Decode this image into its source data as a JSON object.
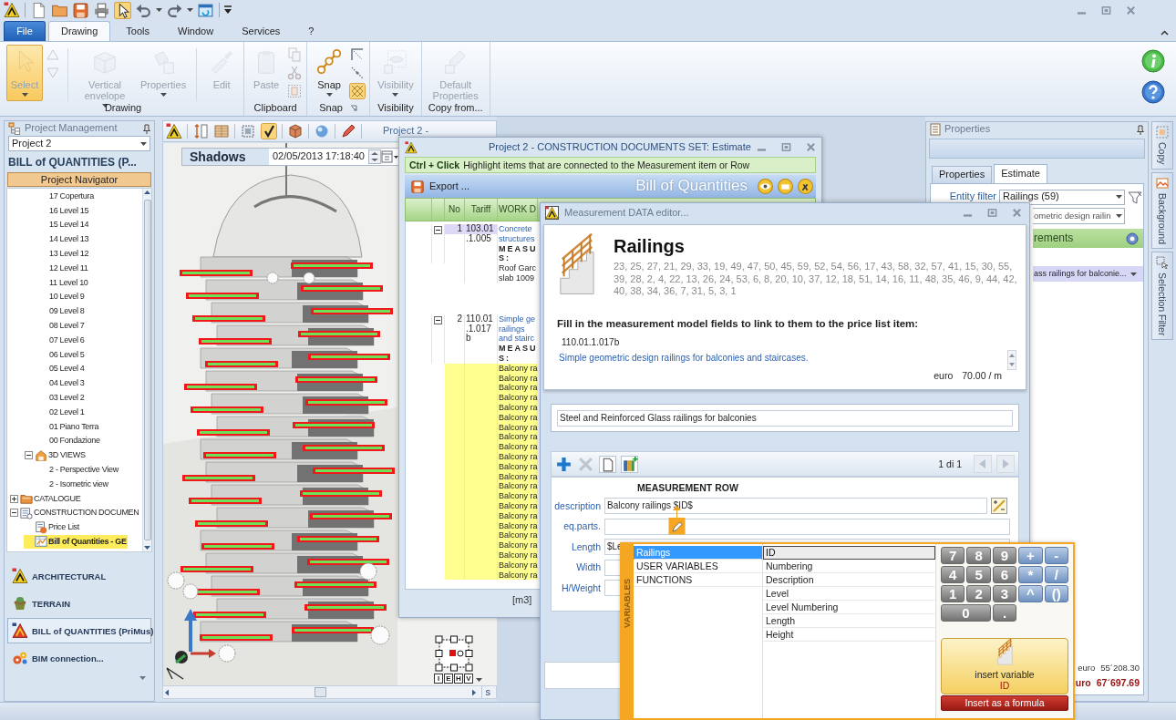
{
  "quick_access": [
    {
      "pressed": false
    },
    {
      "pressed": false
    },
    {
      "pressed": false
    },
    {
      "pressed": false
    },
    {
      "pressed": true
    },
    {
      "pressed": false,
      "dropdown": true
    },
    {
      "pressed": false,
      "dropdown": true
    },
    {
      "pressed": false
    }
  ],
  "ribbon": {
    "tabs": [
      {
        "label": "File",
        "kind": "application",
        "selected": false
      },
      {
        "label": "Drawing",
        "kind": "tab",
        "selected": true
      },
      {
        "label": "Tools",
        "kind": "tab",
        "selected": false
      },
      {
        "label": "Window",
        "kind": "tab",
        "selected": false
      },
      {
        "label": "Services",
        "kind": "tab",
        "selected": false
      },
      {
        "label": "?",
        "kind": "tab",
        "selected": false
      }
    ],
    "groups": [
      {
        "label": "Drawing",
        "buttons": [
          {
            "kind": "large",
            "label": "Select",
            "disabled": true,
            "pressed": true,
            "dropdown": true
          },
          {
            "kind": "small_stack",
            "items": [
              {
                "disabled": true,
                "pressed": false
              },
              {
                "disabled": true,
                "pressed": false
              }
            ]
          },
          {
            "kind": "separator"
          },
          {
            "kind": "large",
            "label": "Vertical envelope",
            "disabled": true,
            "pressed": false,
            "dropdown": true
          },
          {
            "kind": "large",
            "label": "Properties",
            "disabled": true,
            "pressed": false,
            "dropdown": true
          },
          {
            "kind": "separator"
          },
          {
            "kind": "large",
            "label": "Edit",
            "disabled": true,
            "pressed": false
          }
        ]
      },
      {
        "label": "Clipboard",
        "buttons": [
          {
            "kind": "large",
            "label": "Paste",
            "disabled": true,
            "pressed": false
          },
          {
            "kind": "small_stack",
            "items": [
              {
                "disabled": true,
                "pressed": false
              },
              {
                "disabled": true,
                "pressed": false
              },
              {
                "disabled": true,
                "pressed": false
              }
            ]
          }
        ]
      },
      {
        "label": "Snap",
        "launcher": true,
        "buttons": [
          {
            "kind": "large",
            "label": "Snap",
            "disabled": false,
            "pressed": false,
            "dropdown": true
          },
          {
            "kind": "small_stack",
            "items": [
              {
                "disabled": false,
                "pressed": false
              },
              {
                "disabled": false,
                "pressed": false
              },
              {
                "disabled": false,
                "pressed": true
              }
            ]
          }
        ]
      },
      {
        "label": "Visibility",
        "buttons": [
          {
            "kind": "large",
            "label": "Visibility",
            "disabled": true,
            "pressed": false,
            "dropdown": true
          }
        ]
      },
      {
        "label": "Copy from...",
        "buttons": [
          {
            "kind": "large",
            "label": "Default Properties",
            "disabled": true,
            "pressed": false
          }
        ]
      }
    ]
  },
  "project_panel": {
    "title": "Project Management",
    "project": "Project 2",
    "heading": "BILL of QUANTITIES (P...",
    "navigator": "Project Navigator",
    "tree": [
      {
        "children": [
          {
            "children": [
              {
                "label": "17 Copertura",
                "selected": false
              },
              {
                "label": "16 Level 15",
                "selected": false
              },
              {
                "label": "15 Level 14",
                "selected": false
              },
              {
                "label": "14 Level 13",
                "selected": false
              },
              {
                "label": "13 Level 12",
                "selected": false
              },
              {
                "label": "12 Level 11",
                "selected": false
              },
              {
                "label": "11 Level 10",
                "selected": false
              },
              {
                "label": "10 Level 9",
                "selected": false
              },
              {
                "label": "09 Level 8",
                "selected": false
              },
              {
                "label": "08 Level 7",
                "selected": false
              },
              {
                "label": "07 Level 6",
                "selected": false
              },
              {
                "label": "06 Level 5",
                "selected": false
              },
              {
                "label": "05 Level 4",
                "selected": false
              },
              {
                "label": "04 Level 3",
                "selected": false
              },
              {
                "label": "03 Level 2",
                "selected": false
              },
              {
                "label": "02 Level 1",
                "selected": false
              },
              {
                "label": "01 Piano Terra",
                "selected": false
              },
              {
                "label": "00 Fondazione",
                "selected": false
              }
            ]
          },
          {
            "label": "3D VIEWS",
            "expanded": true,
            "selected": false,
            "children": [
              {
                "label": "2 - Perspective View",
                "selected": false
              },
              {
                "label": "2 - Isometric view",
                "selected": false
              }
            ]
          }
        ]
      },
      {
        "label": "CATALOGUE",
        "expanded": false,
        "selected": false
      },
      {
        "label": "CONSTRUCTION DOCUMEN",
        "expanded": true,
        "selected": false,
        "children": [
          {
            "label": "Price List",
            "selected": false
          },
          {
            "label": "Bill of Quantities - GE",
            "selected": true
          }
        ]
      }
    ],
    "modules": [
      {
        "label": "ARCHITECTURAL",
        "selected": false
      },
      {
        "label": "TERRAIN",
        "selected": false
      },
      {
        "label": "BILL of QUANTITIES (PriMus)",
        "selected": true
      },
      {
        "label": "BIM connection...",
        "selected": false
      }
    ]
  },
  "view_3d": {
    "toolbar": [
      {
        "pressed": false
      },
      {
        "pressed": false
      },
      {
        "pressed": false
      },
      {
        "pressed": false
      },
      {
        "pressed": true
      },
      {
        "pressed": false
      },
      {
        "pressed": false
      },
      {
        "pressed": false
      }
    ],
    "tab_title": "Project 2 -",
    "shadows_label": "Shadows",
    "shadows_datetime": "02/05/2013 17:18:40",
    "cube_buttons": [
      "I",
      "E",
      "H",
      "V"
    ],
    "scroll_tab": "s"
  },
  "estimate_window": {
    "title": "Project 2 - CONSTRUCTION DOCUMENTS SET: Estimate",
    "hint_key": "Ctrl + Click",
    "hint": "Highlight items that are connected to the Measurement item or Row",
    "export": "Export ...",
    "heading": "Bill of Quantities",
    "columns": [
      "No",
      "Tariff",
      "WORK D"
    ],
    "rows": [
      {
        "no": "1",
        "tariff": "103.01.1.005",
        "selected": true,
        "expanded": true,
        "description": [
          "Concrete",
          "structures"
        ],
        "section": [
          "MEASU",
          "S:"
        ],
        "measurements": [
          {
            "text": "Roof Garc",
            "highlighted": false
          },
          {
            "text": "slab 1009",
            "highlighted": false
          }
        ]
      },
      {
        "no": "2",
        "tariff": "110.01.1.017b",
        "selected": false,
        "expanded": true,
        "description": [
          "Simple ge",
          "railings",
          "and stairc"
        ],
        "section": [
          "MEASU",
          "S:"
        ],
        "measurements": [
          {
            "text": "Balcony ra",
            "highlighted": true
          },
          {
            "text": "Balcony ra",
            "highlighted": true
          },
          {
            "text": "Balcony ra",
            "highlighted": true
          },
          {
            "text": "Balcony ra",
            "highlighted": true
          },
          {
            "text": "Balcony ra",
            "highlighted": true
          },
          {
            "text": "Balcony ra",
            "highlighted": true
          },
          {
            "text": "Balcony ra",
            "highlighted": true
          },
          {
            "text": "Balcony ra",
            "highlighted": true
          },
          {
            "text": "Balcony ra",
            "highlighted": true
          },
          {
            "text": "Balcony ra",
            "highlighted": true
          },
          {
            "text": "Balcony ra",
            "highlighted": true
          },
          {
            "text": "Balcony ra",
            "highlighted": true
          },
          {
            "text": "Balcony ra",
            "highlighted": true
          },
          {
            "text": "Balcony ra",
            "highlighted": true
          },
          {
            "text": "Balcony ra",
            "highlighted": true
          },
          {
            "text": "Balcony ra",
            "highlighted": true
          },
          {
            "text": "Balcony ra",
            "highlighted": true
          },
          {
            "text": "Balcony ra",
            "highlighted": true
          },
          {
            "text": "Balcony ra",
            "highlighted": true
          },
          {
            "text": "Balcony ra",
            "highlighted": true
          },
          {
            "text": "Balcony ra",
            "highlighted": true
          },
          {
            "text": "Balcony ra",
            "highlighted": true
          }
        ]
      }
    ],
    "footer": "[m3]"
  },
  "measurement_editor": {
    "title": "Measurement DATA editor...",
    "entity": "Railings",
    "ids": "23, 25, 27, 21, 29, 33, 19, 49, 47, 50, 45, 59, 52, 54, 56, 17, 43, 58, 32, 57, 41, 15, 30, 55, 39, 28, 2, 4, 22, 13, 26, 24, 53, 6, 8, 20, 10, 37, 12, 18, 51, 14, 16, 11, 48, 35, 46, 9, 44, 42, 40, 38, 34, 36, 7, 31, 5, 3, 1",
    "instruction": "Fill in the measurement model fields to link to them to the price list item:",
    "item_code": "110.01.1.017b",
    "item_description": "Simple geometric design railings for balconies and staircases.",
    "currency": "euro",
    "price": "70.00 / m",
    "row_title": "Steel and Reinforced Glass railings for balconies",
    "toolbar": [
      {
        "disabled": false
      },
      {
        "disabled": true
      },
      {
        "disabled": false
      },
      {
        "disabled": false
      }
    ],
    "pager": "1 di 1",
    "pager_buttons": [
      {
        "disabled": true
      },
      {
        "disabled": true
      }
    ],
    "section_title": "MEASUREMENT ROW",
    "fields": [
      {
        "label": "description",
        "value": "Balcony railings $ID$",
        "kind": "with_editor"
      },
      {
        "label": "eq.parts.",
        "kind": "plain"
      },
      {
        "label": "Length",
        "value": "$Le",
        "kind": "plain"
      },
      {
        "label": "Width",
        "kind": "plain"
      },
      {
        "label": "H/Weight",
        "kind": "plain"
      }
    ]
  },
  "variables_popup": {
    "title": "VARIABLES",
    "sources": [
      {
        "label": "Railings",
        "selected": true
      },
      {
        "label": "USER VARIABLES",
        "selected": false
      },
      {
        "label": "FUNCTIONS",
        "selected": false
      }
    ],
    "variables": [
      {
        "label": "ID",
        "selected": true
      },
      {
        "label": "Numbering",
        "selected": false
      },
      {
        "label": "Description",
        "selected": false
      },
      {
        "label": "Level",
        "selected": false
      },
      {
        "label": "Level Numbering",
        "selected": false
      },
      {
        "label": "Length",
        "selected": false
      },
      {
        "label": "Height",
        "selected": false
      }
    ],
    "keypad": [
      {
        "label": "7",
        "kind": "digit"
      },
      {
        "label": "8",
        "kind": "digit"
      },
      {
        "label": "9",
        "kind": "digit"
      },
      {
        "label": "+",
        "kind": "operator"
      },
      {
        "label": "-",
        "kind": "operator"
      },
      {
        "label": "4",
        "kind": "digit"
      },
      {
        "label": "5",
        "kind": "digit"
      },
      {
        "label": "6",
        "kind": "digit"
      },
      {
        "label": "*",
        "kind": "operator"
      },
      {
        "label": "/",
        "kind": "operator"
      },
      {
        "label": "1",
        "kind": "digit"
      },
      {
        "label": "2",
        "kind": "digit"
      },
      {
        "label": "3",
        "kind": "digit"
      },
      {
        "label": "^",
        "kind": "operator"
      },
      {
        "label": "()",
        "kind": "operator"
      },
      {
        "label": "0",
        "kind": "wide_digit"
      },
      {
        "label": ".",
        "kind": "digit"
      }
    ],
    "insert_label": "insert variable",
    "insert_variable": "ID",
    "formula_button": "Insert as a formula"
  },
  "properties_panel": {
    "title": "Properties",
    "tabs": [
      {
        "label": "Properties",
        "selected": false
      },
      {
        "label": "Estimate",
        "selected": true
      }
    ],
    "filter_label": "Entity filter",
    "filter_value": "Railings (59)",
    "item_value": "ometric design railin",
    "section": "rements",
    "row": "ass railings for balconie...",
    "totals": [
      {
        "kind": "subtotal",
        "currency": "euro",
        "amount": "55´208.30"
      },
      {
        "kind": "total",
        "currency": "uro",
        "amount": "67´697.69"
      }
    ]
  },
  "side_tabs": [
    "Copy",
    "Background",
    "Selection Filter"
  ]
}
